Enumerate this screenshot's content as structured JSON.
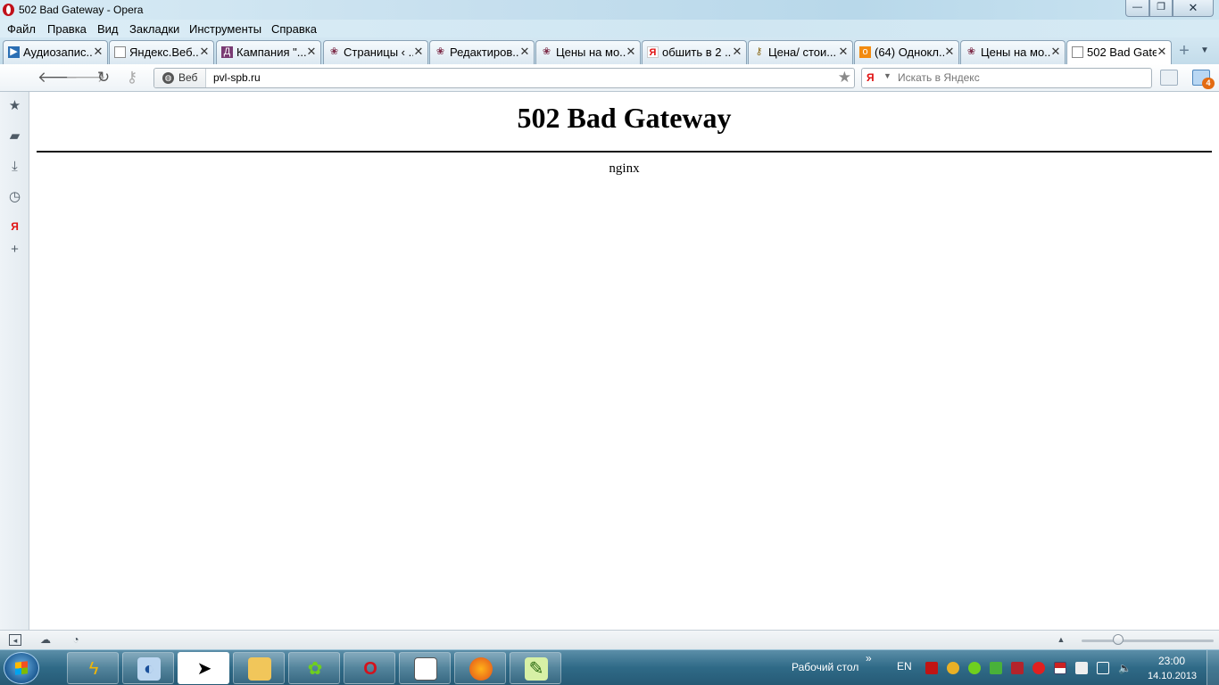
{
  "window": {
    "title": "502 Bad Gateway - Opera",
    "minimize_label": "—",
    "maximize_label": "❐",
    "close_label": "✕"
  },
  "menu": [
    "Файл",
    "Правка",
    "Вид",
    "Закладки",
    "Инструменты",
    "Справка"
  ],
  "tabs": [
    {
      "label": "Аудиозапис...",
      "icon": "play-icon",
      "active": false
    },
    {
      "label": "Яндекс.Веб...",
      "icon": "page-icon",
      "active": false
    },
    {
      "label": "Кампания \"...",
      "icon": "yandex-direct-icon",
      "active": false
    },
    {
      "label": "Страницы ‹ ...",
      "icon": "wordpress-icon",
      "active": false
    },
    {
      "label": "Редактиров...",
      "icon": "wordpress-icon",
      "active": false
    },
    {
      "label": "Цены на мо...",
      "icon": "wordpress-icon",
      "active": false
    },
    {
      "label": "обшить в 2 ...",
      "icon": "yandex-icon",
      "active": false
    },
    {
      "label": "Цена/ стои...",
      "icon": "key-icon",
      "active": false
    },
    {
      "label": "(64) Однокл...",
      "icon": "odnoklassniki-icon",
      "active": false
    },
    {
      "label": "Цены на мо...",
      "icon": "wordpress-icon",
      "active": false
    },
    {
      "label": "502 Bad Gate...",
      "icon": "page-icon",
      "active": true
    }
  ],
  "tab_close": "✕",
  "addressbar": {
    "badge_label": "Веб",
    "url": "pvl-spb.ru",
    "search_placeholder": "Искать в Яндекс",
    "mail_count": "4"
  },
  "page": {
    "heading": "502 Bad Gateway",
    "server": "nginx"
  },
  "taskbar": {
    "desktop_label": "Рабочий стол",
    "language": "EN",
    "time": "23:00",
    "date": "14.10.2013"
  },
  "colors": {
    "opera_red": "#c0101a",
    "taskbar": "#2f6a87",
    "mail_badge": "#e36b12"
  }
}
